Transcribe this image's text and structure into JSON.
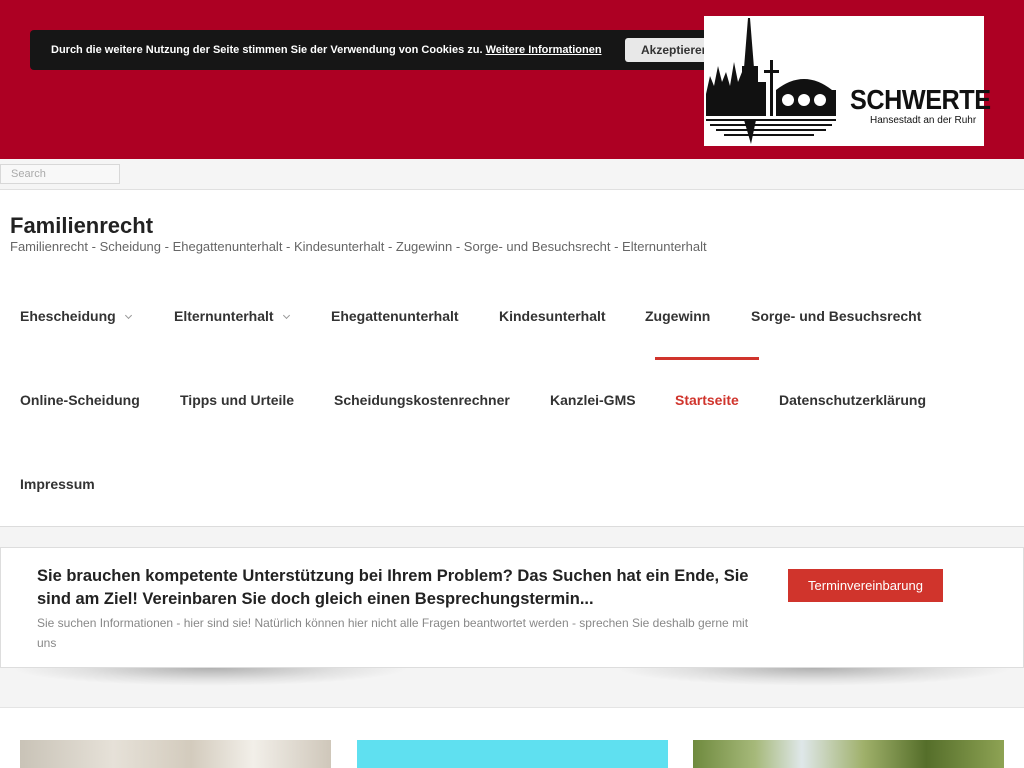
{
  "cookie_bar": {
    "message": "Durch die weitere Nutzung der Seite stimmen Sie der Verwendung von Cookies zu.",
    "link_label": "Weitere Informationen",
    "accept_label": "Akzeptieren"
  },
  "logo": {
    "title": "SCHWERTE",
    "subtitle": "Hansestadt an der Ruhr"
  },
  "search": {
    "placeholder": "Search"
  },
  "site": {
    "title": "Familienrecht",
    "tagline": "Familienrecht - Scheidung - Ehegattenunterhalt - Kindesunterhalt - Zugewinn - Sorge- und Besuchsrecht - Elternunterhalt"
  },
  "nav": {
    "items": [
      {
        "label": "Ehescheidung",
        "has_submenu": true
      },
      {
        "label": "Elternunterhalt",
        "has_submenu": true
      },
      {
        "label": "Ehegattenunterhalt"
      },
      {
        "label": "Kindesunterhalt"
      },
      {
        "label": "Zugewinn"
      },
      {
        "label": "Sorge- und Besuchsrecht"
      },
      {
        "label": "Online-Scheidung"
      },
      {
        "label": "Tipps und Urteile"
      },
      {
        "label": "Scheidungskostenrechner"
      },
      {
        "label": "Kanzlei-GMS"
      },
      {
        "label": "Startseite",
        "active": true
      },
      {
        "label": "Datenschutzerklärung"
      },
      {
        "label": "Impressum"
      }
    ]
  },
  "cta": {
    "heading": "Sie brauchen kompetente Unterstützung bei Ihrem Problem? Das Suchen hat ein Ende, Sie sind am Ziel! Vereinbaren Sie doch gleich einen Besprechungstermin...",
    "text": "Sie suchen Informationen - hier sind sie! Natürlich können hier nicht alle Fragen beantwortet werden - sprechen Sie deshalb gerne mit uns",
    "button_label": "Terminvereinbarung"
  },
  "colors": {
    "banner": "#ad0023",
    "accent": "#d0342c",
    "cookie_bar": "#161616"
  }
}
